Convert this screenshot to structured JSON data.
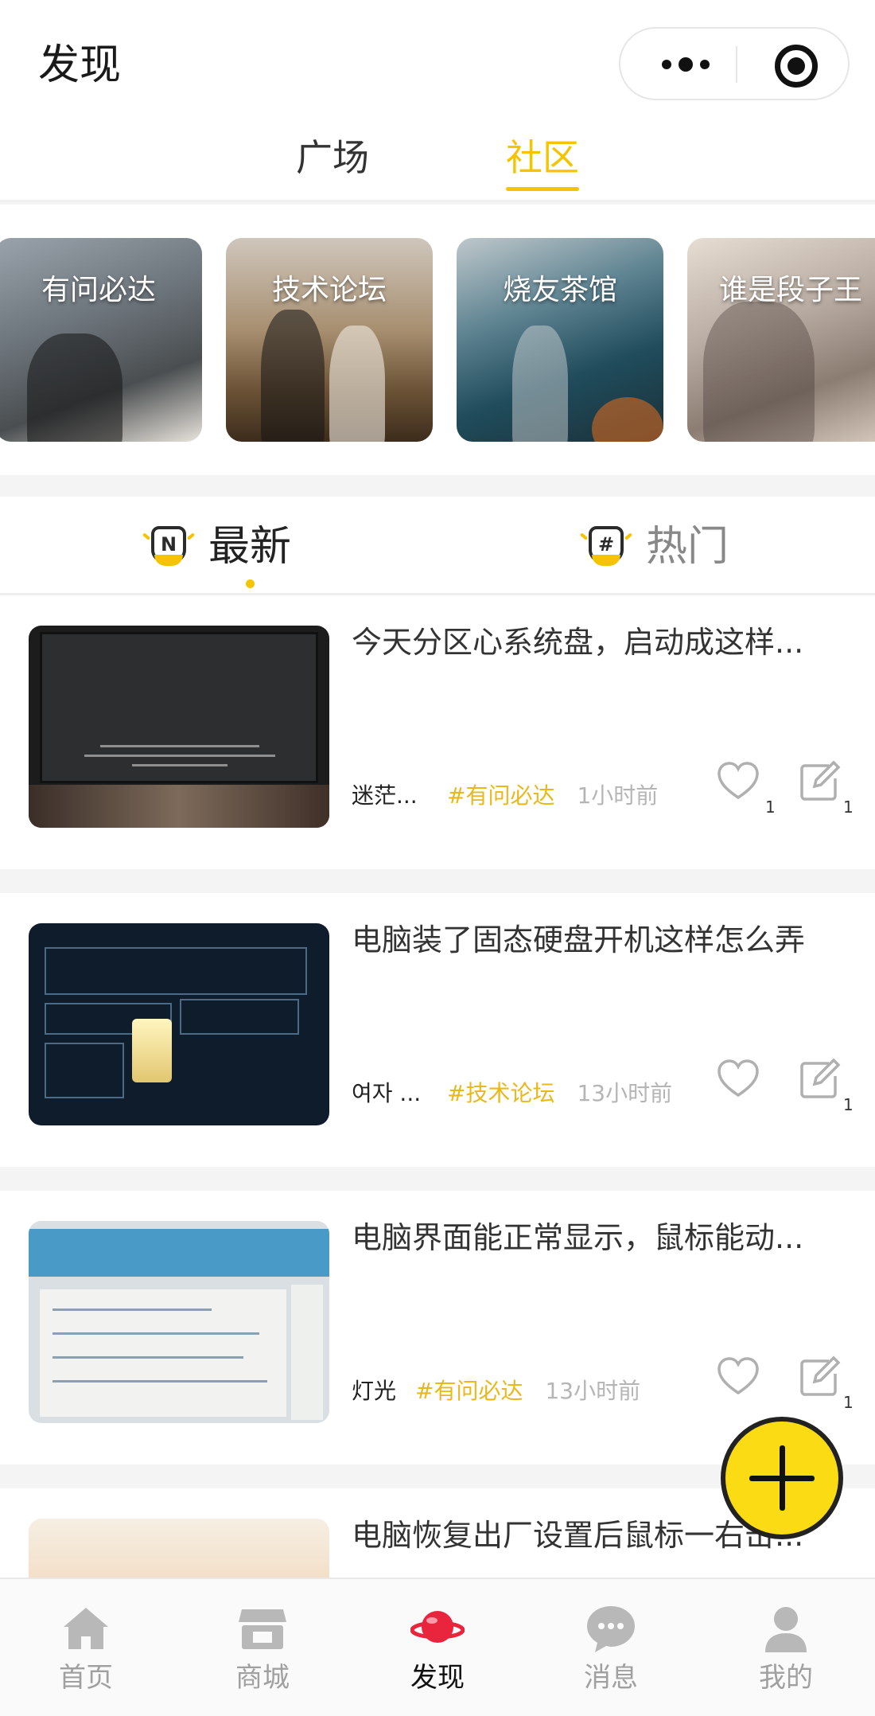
{
  "header": {
    "title": "发现"
  },
  "main_tabs": [
    {
      "label": "广场",
      "active": false
    },
    {
      "label": "社区",
      "active": true
    }
  ],
  "categories": [
    {
      "label": "有问必达"
    },
    {
      "label": "技术论坛"
    },
    {
      "label": "烧友茶馆"
    },
    {
      "label": "谁是段子王"
    }
  ],
  "sub_tabs": [
    {
      "label": "最新",
      "icon": "badge-n-icon",
      "active": true
    },
    {
      "label": "热门",
      "icon": "badge-hash-icon",
      "active": false
    }
  ],
  "badge_glyphs": {
    "latest": "N",
    "hot": "#"
  },
  "posts": [
    {
      "title": "今天分区心系统盘，启动成这样...",
      "author": "迷茫...",
      "tag": "#有问必达",
      "time": "1小时前",
      "likes": "1",
      "comments": "1"
    },
    {
      "title": "电脑装了固态硬盘开机这样怎么弄",
      "author": "여자 ...",
      "tag": "#技术论坛",
      "time": "13小时前",
      "likes": "",
      "comments": "1"
    },
    {
      "title": "电脑界面能正常显示，鼠标能动...",
      "author": "灯光",
      "tag": "#有问必达",
      "time": "13小时前",
      "likes": "",
      "comments": "1"
    },
    {
      "title": "电脑恢复出厂设置后鼠标一右击...",
      "author": "",
      "tag": "",
      "time": "",
      "likes": "",
      "comments": ""
    }
  ],
  "tabbar": [
    {
      "label": "首页",
      "icon": "home-icon"
    },
    {
      "label": "商城",
      "icon": "store-icon"
    },
    {
      "label": "发现",
      "icon": "planet-icon",
      "active": true
    },
    {
      "label": "消息",
      "icon": "chat-bubble-icon"
    },
    {
      "label": "我的",
      "icon": "user-icon"
    }
  ],
  "colors": {
    "accent": "#f5c400",
    "tag": "#e9b81b",
    "fab": "#fadb14"
  }
}
